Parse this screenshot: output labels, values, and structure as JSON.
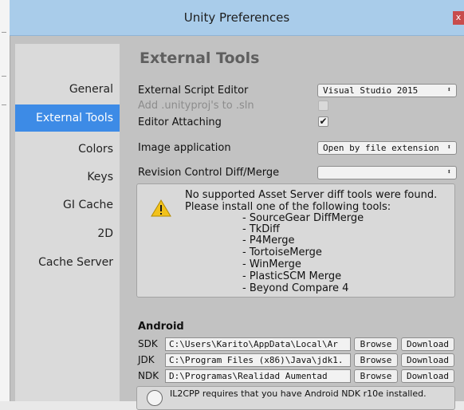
{
  "window": {
    "title": "Unity Preferences",
    "close_glyph": "x"
  },
  "sidebar": {
    "items": [
      {
        "label": "General"
      },
      {
        "label": "External Tools",
        "selected": true
      },
      {
        "label": "Colors"
      },
      {
        "label": "Keys"
      },
      {
        "label": "GI Cache"
      },
      {
        "label": "2D"
      },
      {
        "label": "Cache Server"
      }
    ]
  },
  "main": {
    "heading": "External Tools",
    "external_script_editor": {
      "label": "External Script Editor",
      "value": "Visual Studio 2015"
    },
    "add_unityproj": {
      "label": "Add .unityproj's to .sln",
      "checked": false,
      "enabled": false
    },
    "editor_attaching": {
      "label": "Editor Attaching",
      "checked": true,
      "check_glyph": "✔"
    },
    "image_application": {
      "label": "Image application",
      "value": "Open by file extension"
    },
    "revision_control": {
      "label": "Revision Control Diff/Merge",
      "value": ""
    },
    "dropdown_arrow": "⬍",
    "diff_help": {
      "icon": "warning-icon",
      "lines": [
        "No supported Asset Server diff tools were found.",
        "Please install one of the following tools:",
        "- SourceGear DiffMerge",
        "- TkDiff",
        "- P4Merge",
        "- TortoiseMerge",
        "- WinMerge",
        "- PlasticSCM Merge",
        "- Beyond Compare 4"
      ]
    },
    "android": {
      "title": "Android",
      "sdk": {
        "label": "SDK",
        "path": "C:\\Users\\Karito\\AppData\\Local\\Ar"
      },
      "jdk": {
        "label": "JDK",
        "path": "C:\\Program Files (x86)\\Java\\jdk1."
      },
      "ndk": {
        "label": "NDK",
        "path": "D:\\Programas\\Realidad Aumentad"
      },
      "browse_label": "Browse",
      "download_label": "Download",
      "il2cpp_note": "IL2CPP requires that you have Android NDK r10e installed."
    }
  },
  "colors": {
    "titlebar": "#a9ccea",
    "selection": "#3d8be6",
    "close": "#c84c4c",
    "warning": "#f2c21b"
  }
}
